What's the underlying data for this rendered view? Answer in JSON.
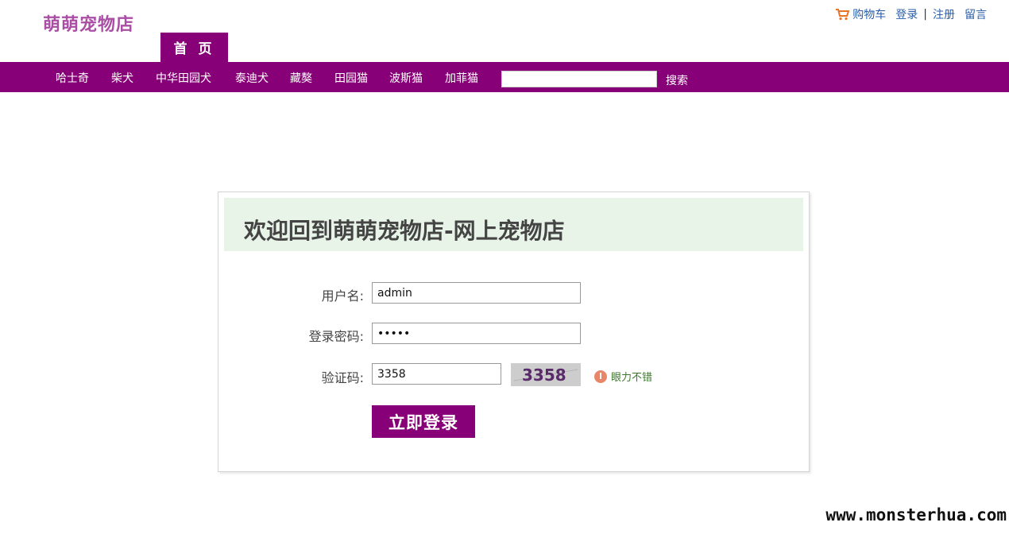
{
  "site": {
    "logo": "萌萌宠物店"
  },
  "top_links": {
    "cart": "购物车",
    "login": "登录",
    "separator": "|",
    "register": "注册",
    "message": "留言"
  },
  "home_tab": "首 页",
  "nav": {
    "items": [
      "哈士奇",
      "柴犬",
      "中华田园犬",
      "泰迪犬",
      "藏獒",
      "田园猫",
      "波斯猫",
      "加菲猫"
    ]
  },
  "search": {
    "button": "搜索",
    "value": ""
  },
  "login": {
    "title": "欢迎回到萌萌宠物店-网上宠物店",
    "username_label": "用户名:",
    "username_value": "admin",
    "password_label": "登录密码:",
    "password_value": "•••••",
    "captcha_label": "验证码:",
    "captcha_value": "3358",
    "captcha_image_text": "3358",
    "captcha_hint": "眼力不错",
    "submit": "立即登录"
  },
  "watermark": "www.monsterhua.com",
  "colors": {
    "brand": "#880077",
    "logo": "#a94ea4",
    "link": "#2a5ea8",
    "header_bg": "#e8f4e8",
    "hint": "#3a7a2a"
  }
}
